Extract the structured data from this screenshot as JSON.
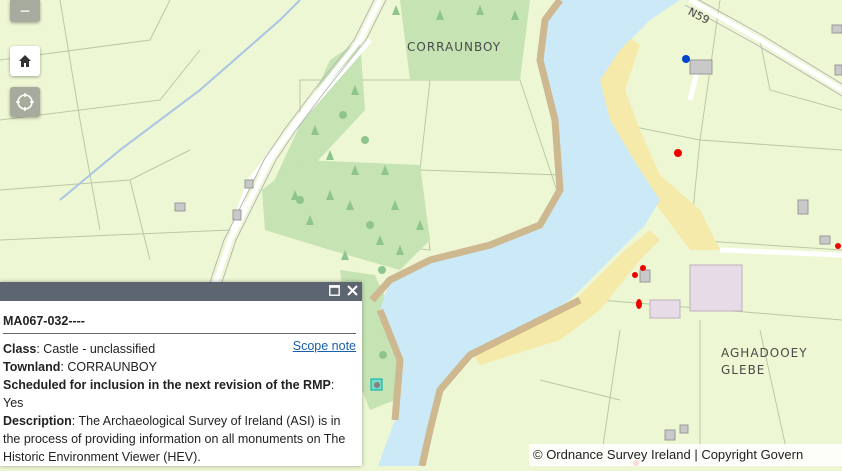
{
  "map": {
    "place_labels": [
      "CORRAUNBOY",
      "AGHADOOEY",
      "GLEBE"
    ],
    "road_label": "N59",
    "attribution": "© Ordnance Survey Ireland | Copyright Govern",
    "colors": {
      "land": "#eef7d4",
      "water": "#cbe9f7",
      "forest": "#c5e3b3",
      "shore": "#f5eaaa",
      "road": "#ffffff",
      "site": "#ee0000"
    }
  },
  "controls": {
    "zoom_out": "−"
  },
  "popup": {
    "title": "MA067-032----",
    "scope_link": "Scope note",
    "class_label": "Class",
    "class_value": ": Castle - unclassified",
    "townland_label": "Townland",
    "townland_value": ": CORRAUNBOY",
    "scheduled_label": "Scheduled for inclusion in the next revision of the RMP",
    "scheduled_value": ": Yes",
    "description_label": "Description",
    "description_value": ": The Archaeological Survey of Ireland (ASI) is in the process of providing information on all monuments on The Historic Environment Viewer (HEV)."
  }
}
